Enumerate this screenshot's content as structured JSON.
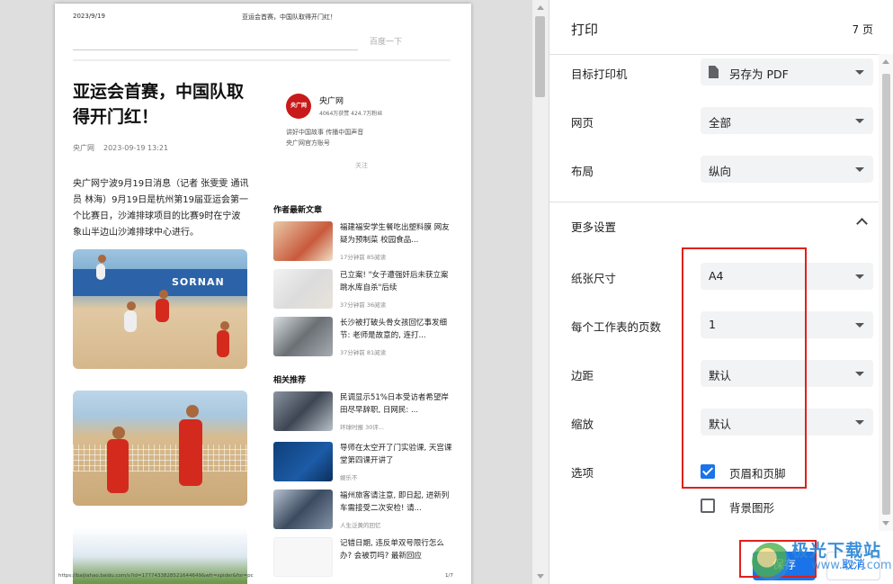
{
  "preview": {
    "header_date": "2023/9/19",
    "header_title": "亚运会首赛，中国队取得开门红！",
    "search_button": "百度一下",
    "article": {
      "title": "亚运会首赛，中国队取得开门红！",
      "source": "央广网",
      "datetime": "2023-09-19 13:21",
      "body": "央广网宁波9月19日消息（记者 张雯雯 通讯员 林海）9月19日是杭州第19届亚运会第一个比赛日，沙滩排球项目的比赛9时在宁波象山半边山沙滩排球中心进行。",
      "photo1_banner": "SORNAN"
    },
    "author": {
      "logo": "央广网",
      "name": "央广网",
      "stats": "4064万获赞 424.7万粉丝",
      "desc1": "讲好中国故事 传播中国声音",
      "desc2": "央广网官方账号",
      "follow": "关注"
    },
    "latest_title": "作者最新文章",
    "latest": [
      {
        "title": "福建福安学生餐吃出塑料膜 网友疑为预制菜 校园食品...",
        "meta": "17分钟前   85阅读"
      },
      {
        "title": "已立案! \"女子遭强奸后未获立案跳水库自杀\"后续",
        "meta": "37分钟前   36阅读"
      },
      {
        "title": "长沙被打破头骨女孩回忆事发细节: 老师是故意的, 连打...",
        "meta": "37分钟前   81阅读"
      }
    ],
    "related_title": "相关推荐",
    "related": [
      {
        "title": "民调显示51%日本受访者希望岸田尽早辞职, 日网民: ...",
        "meta": "环球时报   30评..."
      },
      {
        "title": "导师在太空开了门实验课, 天宫课堂第四课开讲了",
        "meta": "娱乐不"
      },
      {
        "title": "福州旅客请注意, 即日起, 进新列车需接受二次安检! 请...",
        "meta": "人生泛黄的回忆"
      },
      {
        "title": "记错日期, 违反单双号限行怎么办? 会被罚吗? 最新回应",
        "meta": ""
      }
    ],
    "footer_url": "https://baijiahao.baidu.com/s?id=1777433828521644649&wfr=spider&for=pc",
    "footer_page": "1/7"
  },
  "panel": {
    "title": "打印",
    "pages": "7 页",
    "destination_label": "目标打印机",
    "destination_value": "另存为 PDF",
    "pages_label": "网页",
    "pages_value": "全部",
    "layout_label": "布局",
    "layout_value": "纵向",
    "more_settings_label": "更多设置",
    "paper_label": "纸张尺寸",
    "paper_value": "A4",
    "per_sheet_label": "每个工作表的页数",
    "per_sheet_value": "1",
    "margin_label": "边距",
    "margin_value": "默认",
    "scale_label": "缩放",
    "scale_value": "默认",
    "options_label": "选项",
    "header_footer_label": "页眉和页脚",
    "header_footer_checked": true,
    "background_label": "背景图形",
    "background_checked": false,
    "save_label": "保存",
    "cancel_label": "取消"
  },
  "watermark": {
    "text": "极光下载站",
    "sub": "www.xz7.com"
  },
  "colors": {
    "accent": "#1a73e8",
    "highlight": "#e0201c"
  }
}
